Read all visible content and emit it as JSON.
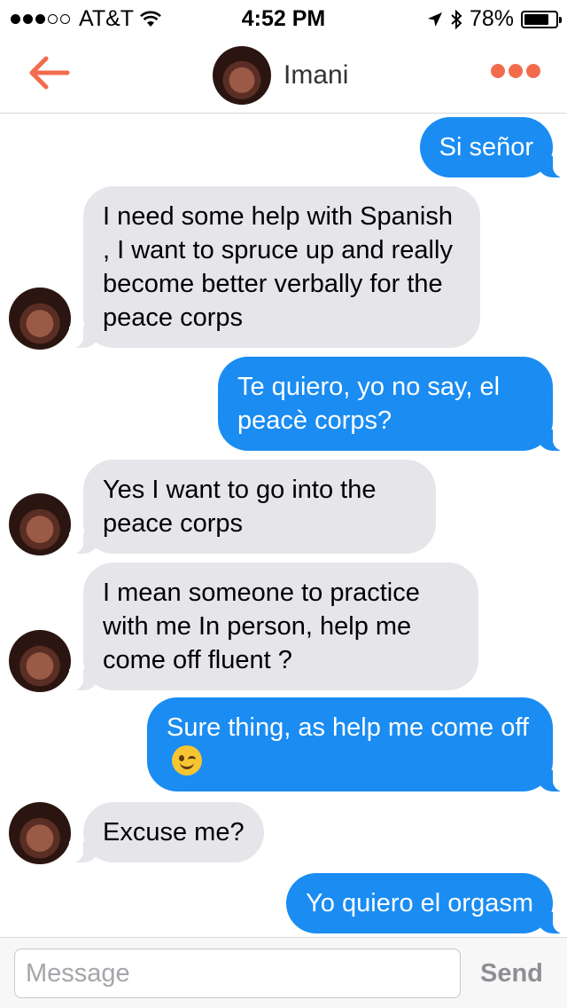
{
  "status_bar": {
    "carrier": "AT&T",
    "signal_dots_filled": 3,
    "signal_dots_total": 5,
    "time": "4:52 PM",
    "battery": "78%",
    "battery_level": 0.78
  },
  "header": {
    "name": "Imani",
    "accent_color": "#f36b4d"
  },
  "messages": [
    {
      "from": "me",
      "text": "Si señor"
    },
    {
      "from": "them",
      "text": "I need some help with Spanish , I want to spruce up and really become better verbally for the peace corps"
    },
    {
      "from": "me",
      "text": "Te quiero, yo no say, el peacè corps?"
    },
    {
      "from": "them",
      "text": "Yes I want to go into the peace corps"
    },
    {
      "from": "them",
      "text": "I mean someone to practice with me In person, help me come off fluent ?"
    },
    {
      "from": "me",
      "text": "Sure thing, as help me come off",
      "emoji": "winking-face"
    },
    {
      "from": "them",
      "text": "Excuse me?"
    },
    {
      "from": "me",
      "text": "Yo quiero el orgasm"
    }
  ],
  "composer": {
    "placeholder": "Message",
    "send_label": "Send"
  },
  "colors": {
    "outgoing_bubble": "#1a8cf2",
    "incoming_bubble": "#e5e5ea"
  }
}
